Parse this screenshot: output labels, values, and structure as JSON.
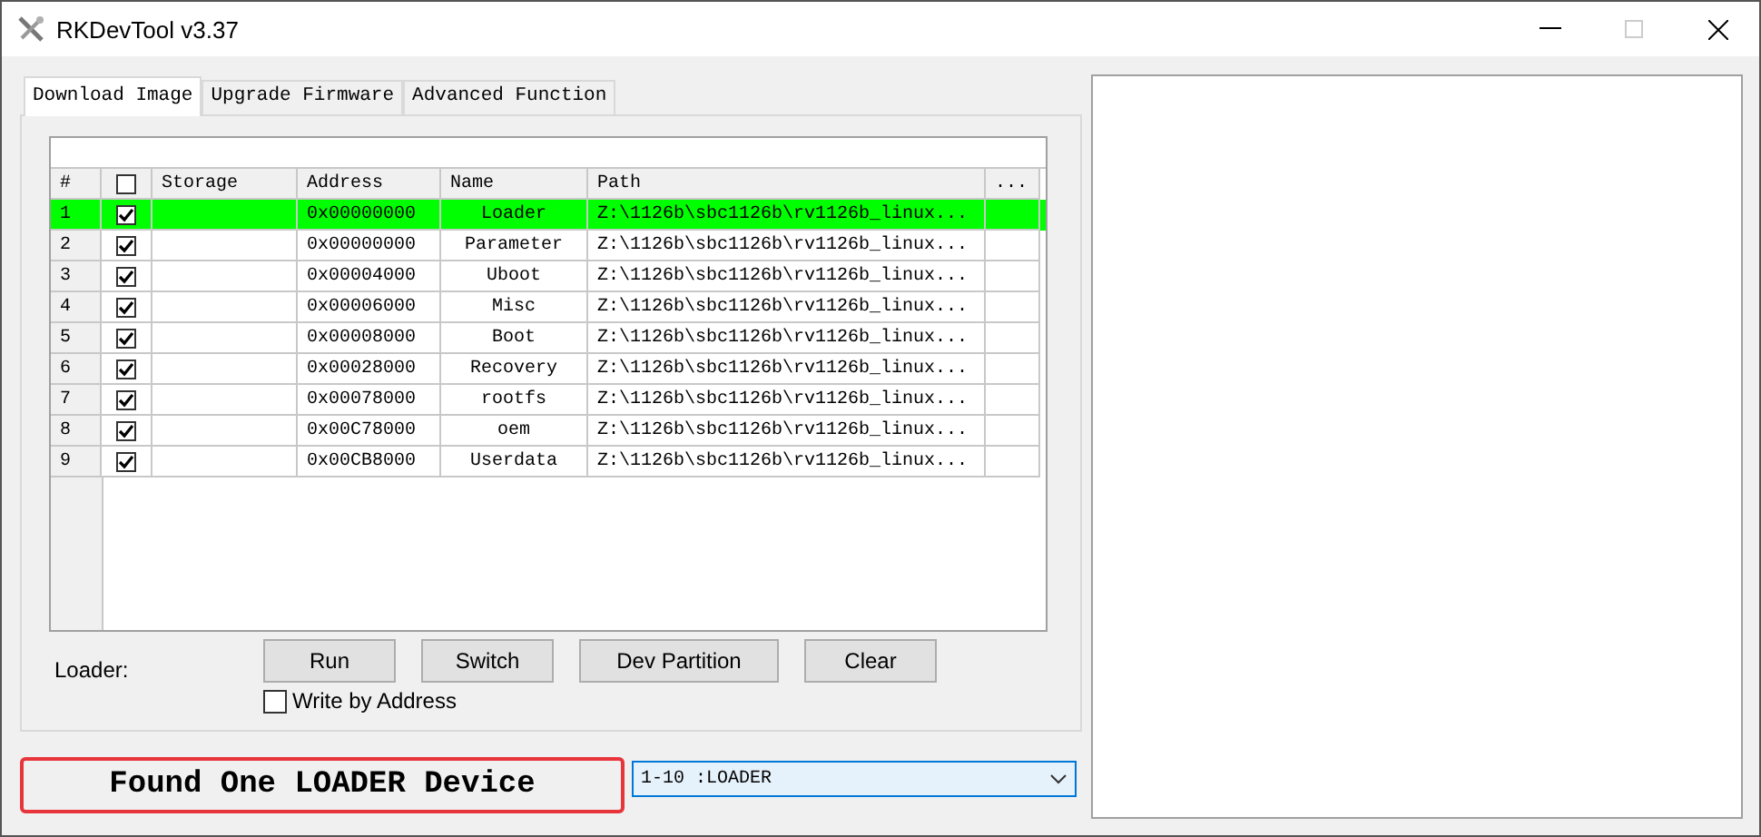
{
  "window": {
    "title": "RKDevTool v3.37"
  },
  "tabs": [
    {
      "label": "Download Image",
      "selected": true
    },
    {
      "label": "Upgrade Firmware",
      "selected": false
    },
    {
      "label": "Advanced Function",
      "selected": false
    }
  ],
  "table": {
    "columns": [
      "#",
      "Storage",
      "Address",
      "Name",
      "Path",
      "..."
    ],
    "header_checked": false,
    "rows": [
      {
        "index": "1",
        "checked": true,
        "selected": true,
        "address": "0x00000000",
        "name": "Loader",
        "path": "Z:\\1126b\\sbc1126b\\rv1126b_linux..."
      },
      {
        "index": "2",
        "checked": true,
        "selected": false,
        "address": "0x00000000",
        "name": "Parameter",
        "path": "Z:\\1126b\\sbc1126b\\rv1126b_linux..."
      },
      {
        "index": "3",
        "checked": true,
        "selected": false,
        "address": "0x00004000",
        "name": "Uboot",
        "path": "Z:\\1126b\\sbc1126b\\rv1126b_linux..."
      },
      {
        "index": "4",
        "checked": true,
        "selected": false,
        "address": "0x00006000",
        "name": "Misc",
        "path": "Z:\\1126b\\sbc1126b\\rv1126b_linux..."
      },
      {
        "index": "5",
        "checked": true,
        "selected": false,
        "address": "0x00008000",
        "name": "Boot",
        "path": "Z:\\1126b\\sbc1126b\\rv1126b_linux..."
      },
      {
        "index": "6",
        "checked": true,
        "selected": false,
        "address": "0x00028000",
        "name": "Recovery",
        "path": "Z:\\1126b\\sbc1126b\\rv1126b_linux..."
      },
      {
        "index": "7",
        "checked": true,
        "selected": false,
        "address": "0x00078000",
        "name": "rootfs",
        "path": "Z:\\1126b\\sbc1126b\\rv1126b_linux..."
      },
      {
        "index": "8",
        "checked": true,
        "selected": false,
        "address": "0x00C78000",
        "name": "oem",
        "path": "Z:\\1126b\\sbc1126b\\rv1126b_linux..."
      },
      {
        "index": "9",
        "checked": true,
        "selected": false,
        "address": "0x00CB8000",
        "name": "Userdata",
        "path": "Z:\\1126b\\sbc1126b\\rv1126b_linux..."
      }
    ]
  },
  "loader_label": "Loader:",
  "buttons": [
    "Run",
    "Switch",
    "Dev Partition",
    "Clear"
  ],
  "write_by_address": {
    "label": "Write by Address",
    "checked": false
  },
  "status": "Found One LOADER Device",
  "device_select": {
    "value": "1-10 :LOADER"
  }
}
